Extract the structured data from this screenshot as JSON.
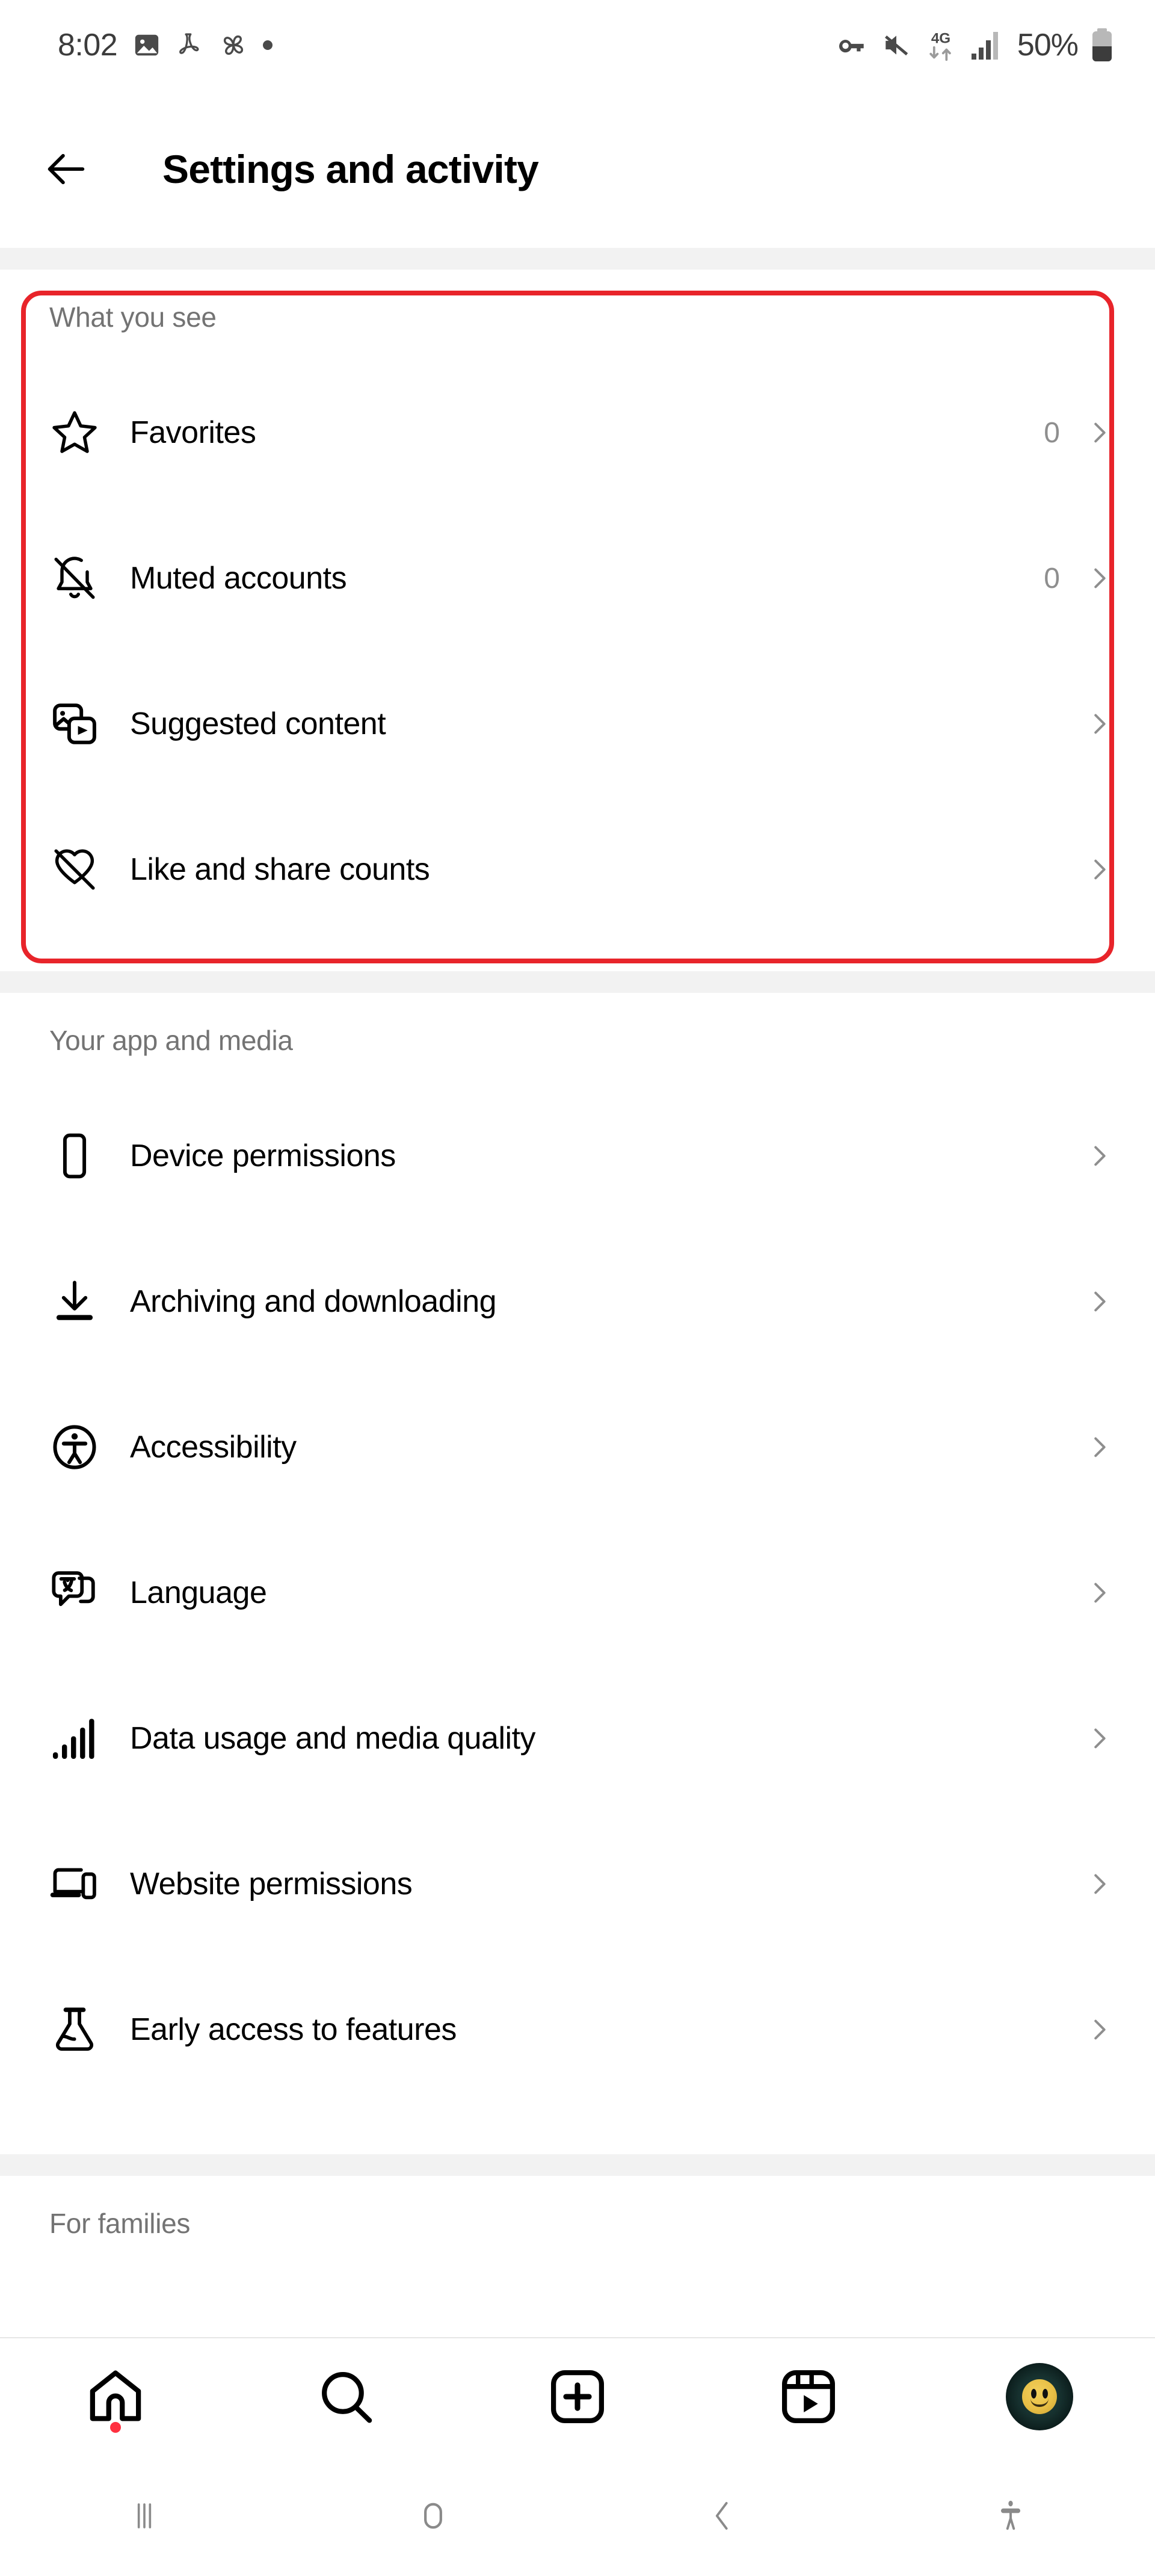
{
  "statusbar": {
    "time": "8:02",
    "left_icons": [
      "image-icon",
      "adobe-acrobat-icon",
      "pinwheel-icon",
      "dot-indicator"
    ],
    "right_icons": [
      "vpn-key-icon",
      "volume-mute-icon",
      "4g-data-icon",
      "signal-bars-icon"
    ],
    "network_label": "4G",
    "battery_percent": "50%"
  },
  "header": {
    "back_label": "back-arrow",
    "title": "Settings and activity"
  },
  "sections": [
    {
      "id": "what-you-see",
      "title": "What you see",
      "highlighted": true,
      "rows": [
        {
          "icon": "star-icon",
          "label": "Favorites",
          "count": "0"
        },
        {
          "icon": "bell-slash-icon",
          "label": "Muted accounts",
          "count": "0"
        },
        {
          "icon": "suggested-media-icon",
          "label": "Suggested content",
          "count": ""
        },
        {
          "icon": "heart-slash-icon",
          "label": "Like and share counts",
          "count": ""
        }
      ]
    },
    {
      "id": "your-app-and-media",
      "title": "Your app and media",
      "highlighted": false,
      "rows": [
        {
          "icon": "phone-icon",
          "label": "Device permissions",
          "count": ""
        },
        {
          "icon": "download-icon",
          "label": "Archiving and downloading",
          "count": ""
        },
        {
          "icon": "accessibility-icon",
          "label": "Accessibility",
          "count": ""
        },
        {
          "icon": "translate-icon",
          "label": "Language",
          "count": ""
        },
        {
          "icon": "signal-bars-icon",
          "label": "Data usage and media quality",
          "count": ""
        },
        {
          "icon": "devices-icon",
          "label": "Website permissions",
          "count": ""
        },
        {
          "icon": "flask-icon",
          "label": "Early access to features",
          "count": ""
        }
      ]
    },
    {
      "id": "for-families",
      "title": "For families",
      "highlighted": false,
      "rows": []
    }
  ],
  "bottom_nav": {
    "items": [
      {
        "icon": "home-icon",
        "label": "Home",
        "badge": true,
        "active": true
      },
      {
        "icon": "search-icon",
        "label": "Search",
        "badge": false,
        "active": false
      },
      {
        "icon": "create-icon",
        "label": "Create",
        "badge": false,
        "active": false
      },
      {
        "icon": "reels-icon",
        "label": "Reels",
        "badge": false,
        "active": false
      },
      {
        "icon": "profile-avatar",
        "label": "Profile",
        "badge": false,
        "active": false
      }
    ]
  },
  "system_nav": {
    "items": [
      {
        "icon": "recents-icon",
        "label": "Recents"
      },
      {
        "icon": "home-circle-icon",
        "label": "Home"
      },
      {
        "icon": "back-chevron-icon",
        "label": "Back"
      },
      {
        "icon": "accessibility-menu-icon",
        "label": "Accessibility menu"
      }
    ]
  },
  "colors": {
    "annotation_red": "#e8242a",
    "band_gray": "#f2f2f2",
    "muted_text": "#737373",
    "count_text": "#8e8e8e",
    "chevron": "#8e8e8e",
    "badge_red": "#ff3040"
  }
}
